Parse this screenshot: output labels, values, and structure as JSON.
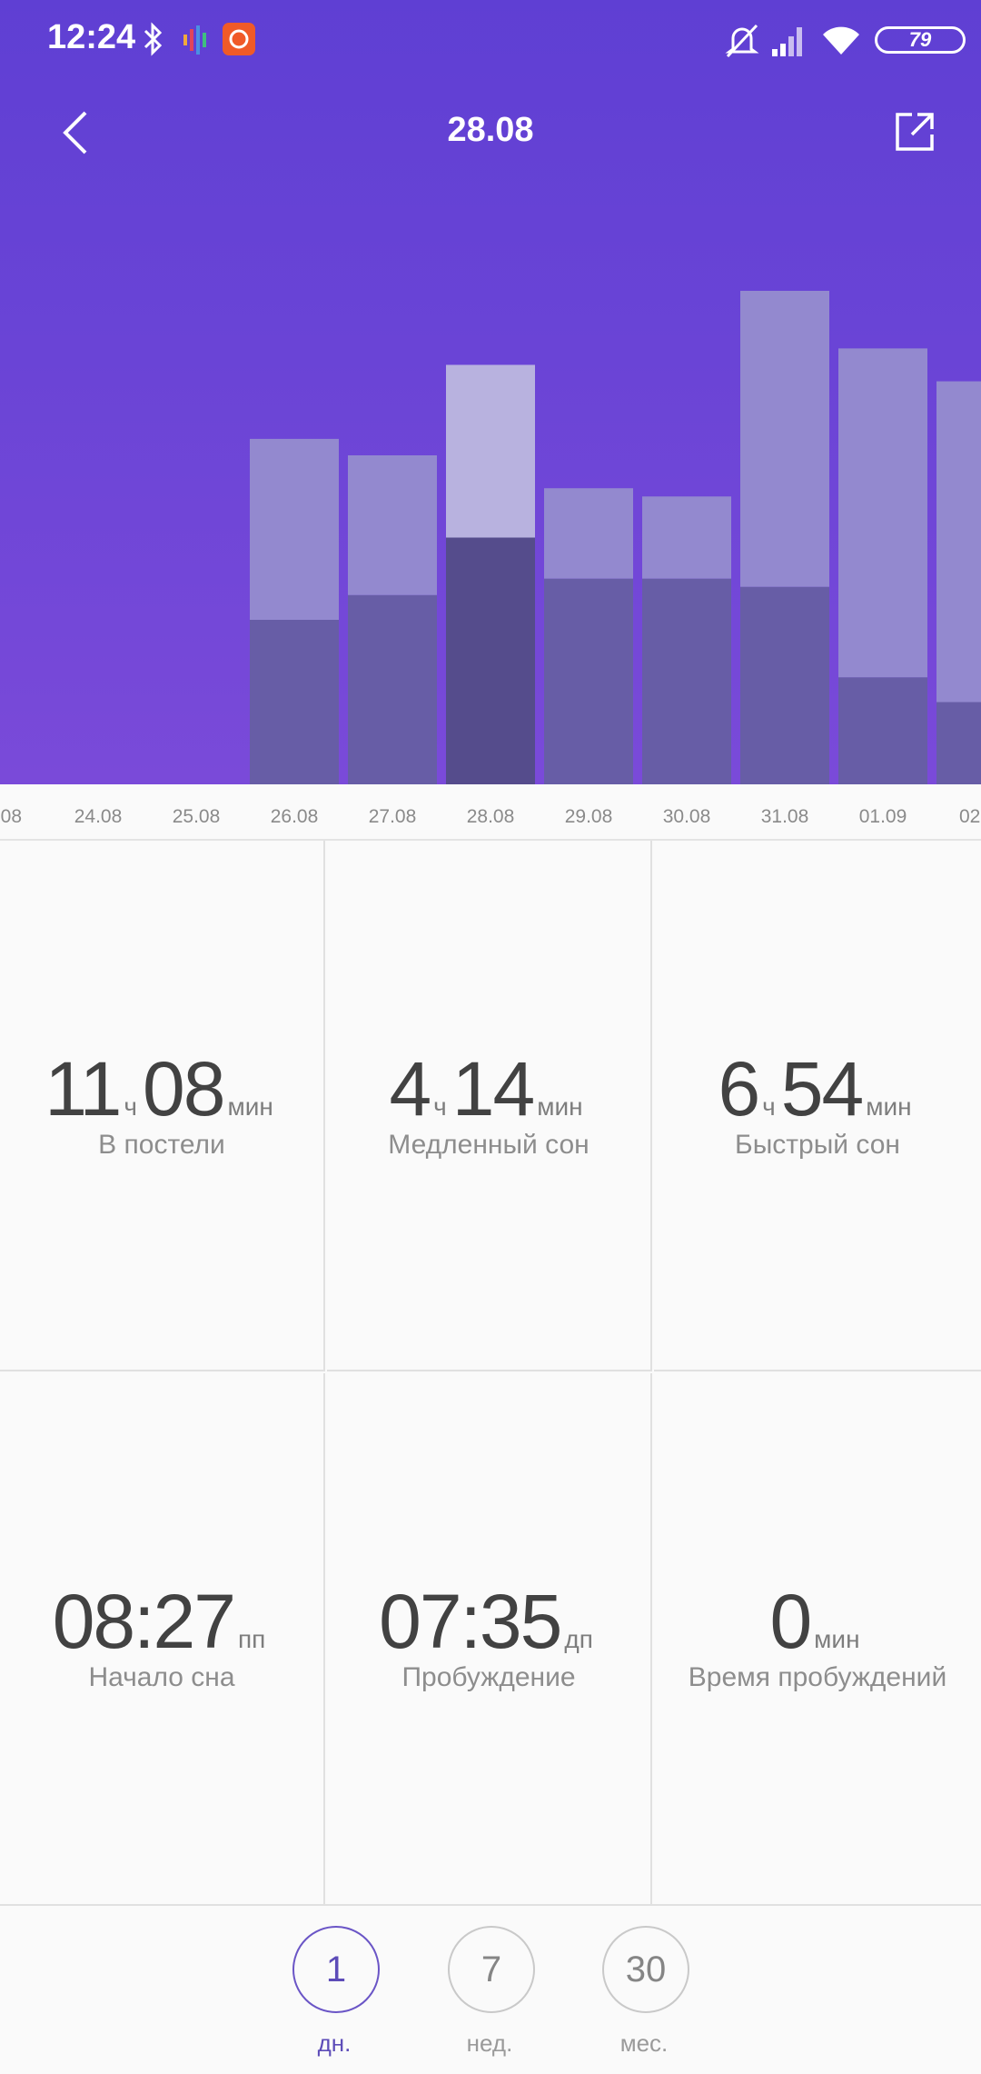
{
  "status_bar": {
    "time": "12:24",
    "battery": "79"
  },
  "header": {
    "title": "28.08"
  },
  "chart_data": {
    "type": "bar",
    "categories": [
      "08",
      "24.08",
      "25.08",
      "26.08",
      "27.08",
      "28.08",
      "29.08",
      "30.08",
      "31.08",
      "01.09",
      "02."
    ],
    "selected": "28.08",
    "series": [
      {
        "values": [
          0,
          0,
          0,
          2.0,
          2.3,
          3.0,
          2.5,
          2.5,
          2.4,
          1.3,
          1.0
        ]
      },
      {
        "values": [
          0,
          0,
          0,
          4.2,
          4.0,
          5.1,
          3.6,
          3.5,
          6.0,
          5.3,
          4.9
        ]
      }
    ],
    "colors": {
      "deep": "#675da6",
      "deep_selected": "#554c8c",
      "light": "#9389cf",
      "light_selected": "#b8b2df"
    }
  },
  "stats": [
    {
      "parts": [
        "11",
        "ч",
        "08",
        "мин"
      ],
      "label": "В постели"
    },
    {
      "parts": [
        "4",
        "ч",
        "14",
        "мин"
      ],
      "label": "Медленный сон"
    },
    {
      "parts": [
        "6",
        "ч",
        "54",
        "мин"
      ],
      "label": "Быстрый сон"
    },
    {
      "parts": [
        "08:27",
        "пп"
      ],
      "label": "Начало сна"
    },
    {
      "parts": [
        "07:35",
        "дп"
      ],
      "label": "Пробуждение"
    },
    {
      "parts": [
        "0",
        "мин"
      ],
      "label": "Время пробуждений"
    }
  ],
  "periods": [
    {
      "value": "1",
      "label": "дн.",
      "active": true
    },
    {
      "value": "7",
      "label": "нед.",
      "active": false
    },
    {
      "value": "30",
      "label": "мес.",
      "active": false
    }
  ]
}
